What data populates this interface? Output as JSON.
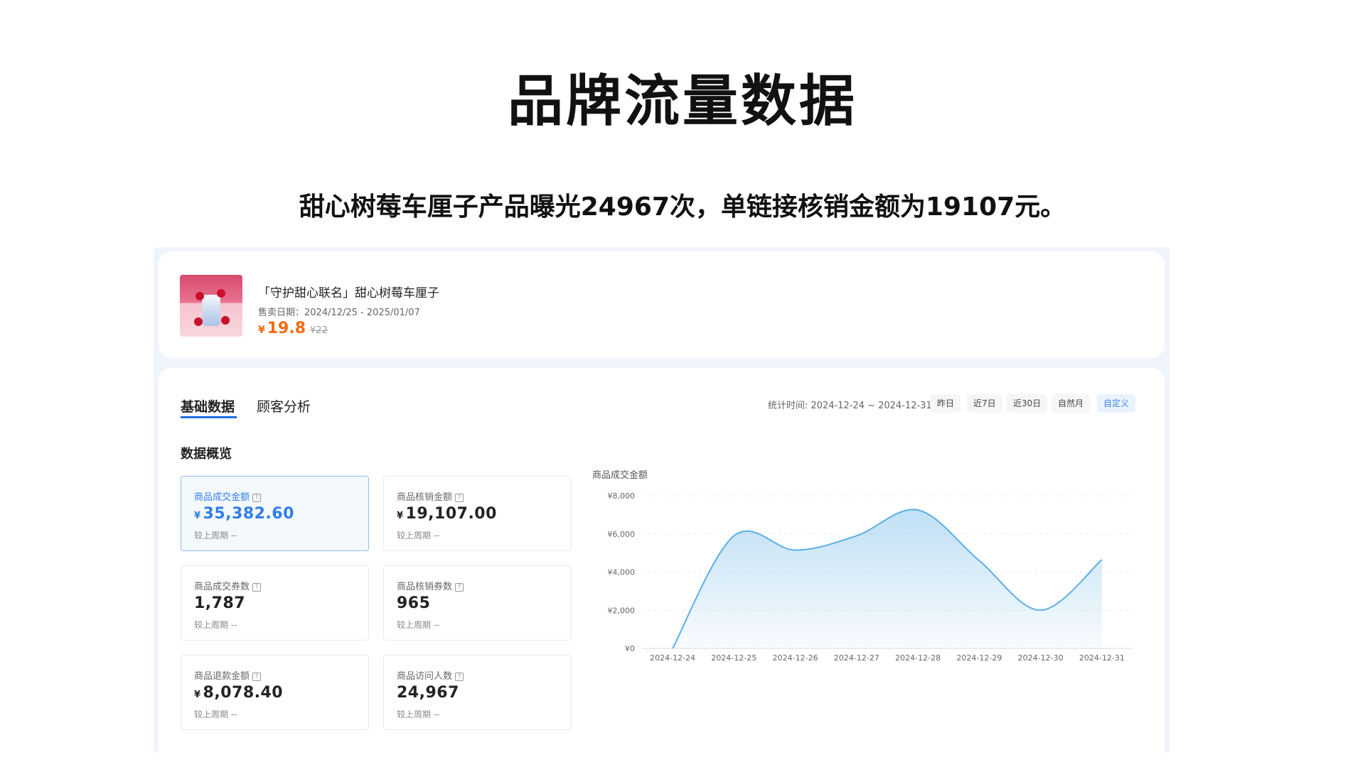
{
  "page": {
    "title": "品牌流量数据",
    "subtitle": "甜心树莓车厘子产品曝光24967次，单链接核销金额为19107元。"
  },
  "product": {
    "name": "「守护甜心联名」甜心树莓车厘子",
    "sale_date": "售卖日期：2024/12/25 - 2025/01/07",
    "currency": "¥",
    "price": "19.8",
    "original_price": "¥22"
  },
  "tabs": [
    {
      "label": "基础数据",
      "active": true
    },
    {
      "label": "顾客分析",
      "active": false
    }
  ],
  "period": {
    "label": "统计时间: 2024-12-24 ~ 2024-12-31",
    "buttons": [
      {
        "label": "昨日",
        "active": false
      },
      {
        "label": "近7日",
        "active": false
      },
      {
        "label": "近30日",
        "active": false
      },
      {
        "label": "自然月",
        "active": false
      },
      {
        "label": "自定义",
        "active": true
      }
    ]
  },
  "overview": {
    "title": "数据概览",
    "metrics": [
      {
        "label": "商品成交金额",
        "currency": "¥",
        "value": "35,382.60",
        "compare": "较上周期 --",
        "selected": true
      },
      {
        "label": "商品核销金额",
        "currency": "¥",
        "value": "19,107.00",
        "compare": "较上周期 --",
        "selected": false
      },
      {
        "label": "商品成交券数",
        "currency": "",
        "value": "1,787",
        "compare": "较上周期 --",
        "selected": false
      },
      {
        "label": "商品核销券数",
        "currency": "",
        "value": "965",
        "compare": "较上周期 --",
        "selected": false
      },
      {
        "label": "商品退款金额",
        "currency": "¥",
        "value": "8,078.40",
        "compare": "较上周期 --",
        "selected": false
      },
      {
        "label": "商品访问人数",
        "currency": "",
        "value": "24,967",
        "compare": "较上周期 --",
        "selected": false
      }
    ]
  },
  "chart_data": {
    "type": "area",
    "title": "商品成交金额",
    "x": [
      "2024-12-24",
      "2024-12-25",
      "2024-12-26",
      "2024-12-27",
      "2024-12-28",
      "2024-12-29",
      "2024-12-30",
      "2024-12-31"
    ],
    "series": [
      {
        "values": [
          0,
          5900,
          5150,
          5900,
          7250,
          4600,
          2000,
          4650
        ]
      }
    ],
    "yticks": [
      "¥8,000",
      "¥6,000",
      "¥4,000",
      "¥2,000",
      "¥0"
    ],
    "ylim": [
      0,
      8000
    ],
    "grid": true,
    "color": "#5aaee6"
  }
}
